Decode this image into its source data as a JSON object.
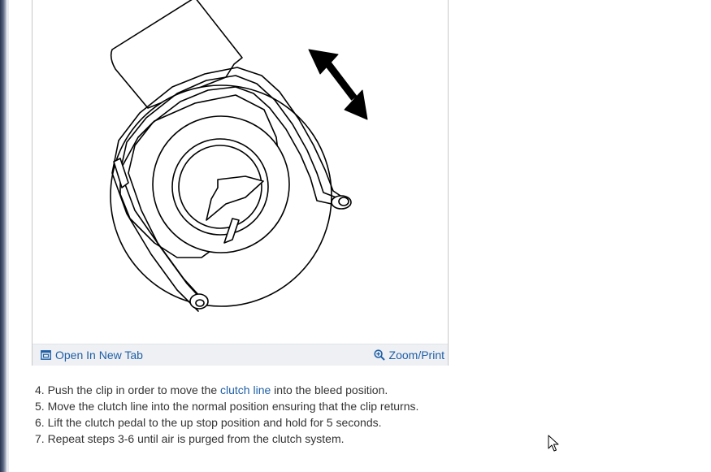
{
  "figure": {
    "toolbar": {
      "open_label": "Open In New Tab",
      "zoom_label": "Zoom/Print"
    }
  },
  "steps": [
    {
      "before": "4. Push the clip in order to move the ",
      "link": "clutch line",
      "after": " into the bleed position."
    },
    {
      "text": "5. Move the clutch line into the normal position ensuring that the clip returns."
    },
    {
      "text": "6. Lift the clutch pedal to the up stop position and hold for 5 seconds."
    },
    {
      "text": "7. Repeat steps 3-6 until air is purged from the clutch system."
    }
  ],
  "colors": {
    "link": "#1f5fa8",
    "toolbar_bg": "#eef0f3",
    "text": "#333333"
  },
  "icons": {
    "open": "open-new-tab-icon",
    "zoom": "zoom-icon",
    "cursor": "mouse-pointer-icon"
  }
}
